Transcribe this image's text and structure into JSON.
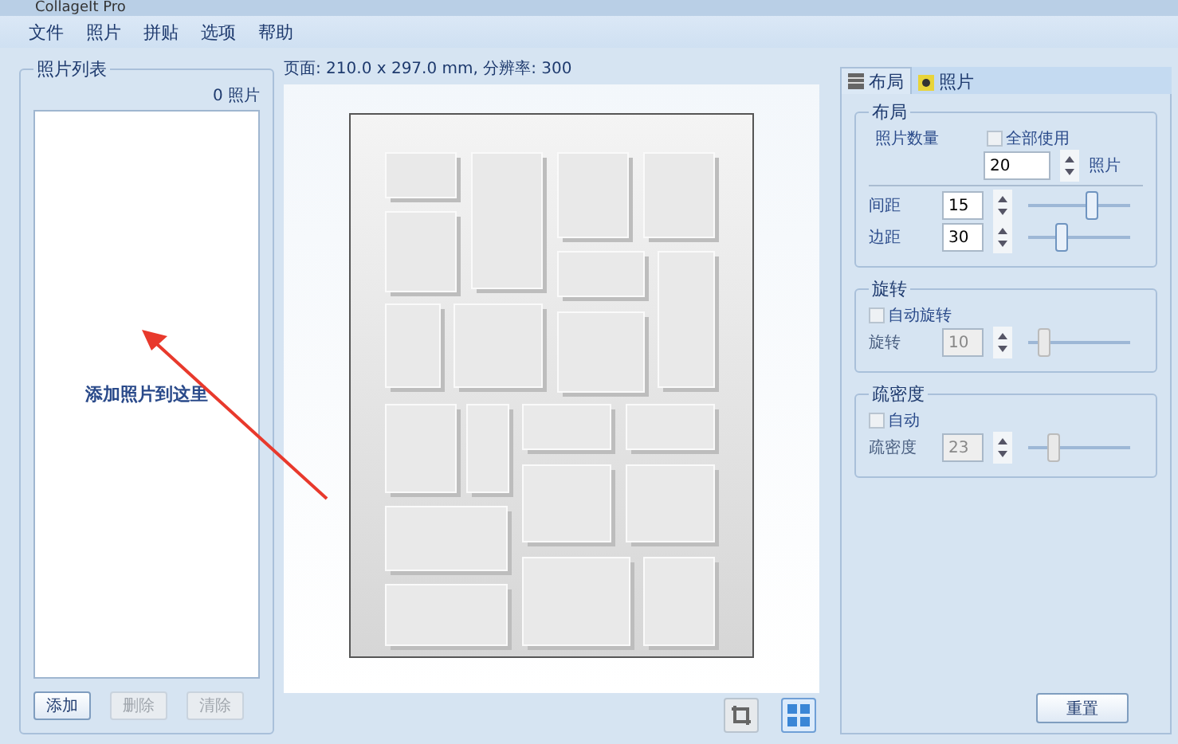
{
  "window": {
    "title": "CollageIt Pro"
  },
  "menu": [
    "文件",
    "照片",
    "拼贴",
    "选项",
    "帮助"
  ],
  "photo_list": {
    "title": "照片列表",
    "count": "0 照片",
    "hint": "添加照片到这里",
    "buttons": [
      {
        "label": "添加",
        "disabled": false
      },
      {
        "label": "删除",
        "disabled": true
      },
      {
        "label": "清除",
        "disabled": true
      }
    ]
  },
  "page_info": "页面: 210.0 x 297.0 mm, 分辨率: 300",
  "tabs": [
    {
      "label": "布局",
      "selected": true
    },
    {
      "label": "照片",
      "selected": false
    }
  ],
  "layout_group": {
    "title": "布局",
    "count_label": "照片数量",
    "use_all": {
      "label": "全部使用",
      "checked": false
    },
    "count_value": "20",
    "count_unit": "照片",
    "sliders": [
      {
        "label": "间距",
        "value": "15",
        "level": 0.63,
        "disabled": false
      },
      {
        "label": "边距",
        "value": "30",
        "level": 0.33,
        "disabled": false
      }
    ]
  },
  "rotation_group": {
    "title": "旋转",
    "auto": {
      "label": "自动旋转",
      "checked": false
    },
    "slider": {
      "label": "旋转",
      "value": "10",
      "level": 0.15,
      "disabled": true
    }
  },
  "density_group": {
    "title": "疏密度",
    "auto": {
      "label": "自动",
      "checked": false
    },
    "slider": {
      "label": "疏密度",
      "value": "23",
      "level": 0.25,
      "disabled": true
    }
  },
  "reset_button": "重置"
}
